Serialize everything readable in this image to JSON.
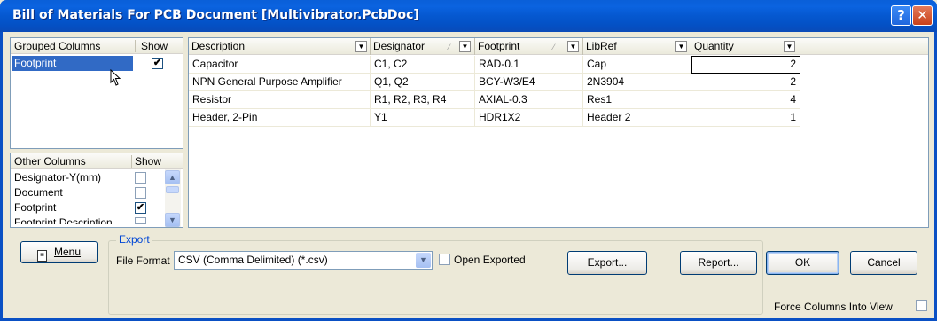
{
  "window": {
    "title": "Bill of Materials For PCB Document [Multivibrator.PcbDoc]",
    "help_glyph": "?",
    "close_glyph": "✕"
  },
  "grouped_columns": {
    "header": "Grouped Columns",
    "show_header": "Show",
    "rows": [
      {
        "label": "Footprint",
        "checked": true
      }
    ]
  },
  "other_columns": {
    "header": "Other Columns",
    "show_header": "Show",
    "rows": [
      {
        "label": "Designator-Y(mm)",
        "checked": false
      },
      {
        "label": "Document",
        "checked": false
      },
      {
        "label": "Footprint",
        "checked": true
      },
      {
        "label": "Footprint Description",
        "checked": false
      }
    ]
  },
  "grid": {
    "columns": [
      "Description",
      "Designator",
      "Footprint",
      "LibRef",
      "Quantity"
    ],
    "rows": [
      {
        "description": "Capacitor",
        "designator": "C1, C2",
        "footprint": "RAD-0.1",
        "libref": "Cap",
        "quantity": "2"
      },
      {
        "description": "NPN General Purpose Amplifier",
        "designator": "Q1, Q2",
        "footprint": "BCY-W3/E4",
        "libref": "2N3904",
        "quantity": "2"
      },
      {
        "description": "Resistor",
        "designator": "R1, R2, R3, R4",
        "footprint": "AXIAL-0.3",
        "libref": "Res1",
        "quantity": "4"
      },
      {
        "description": "Header, 2-Pin",
        "designator": "Y1",
        "footprint": "HDR1X2",
        "libref": "Header 2",
        "quantity": "1"
      }
    ]
  },
  "export": {
    "legend": "Export",
    "file_format_label": "File Format",
    "file_format_value": "CSV (Comma Delimited) (*.csv)",
    "open_exported_label": "Open Exported",
    "open_exported_checked": false,
    "export_button": "Export..."
  },
  "buttons": {
    "menu": "Menu",
    "report": "Report...",
    "ok": "OK",
    "cancel": "Cancel"
  },
  "force_columns": {
    "label": "Force Columns Into View",
    "checked": false
  },
  "colors": {
    "title_bar": "#0558d0",
    "selection": "#316ac5",
    "dialog_bg": "#ece9d8"
  }
}
